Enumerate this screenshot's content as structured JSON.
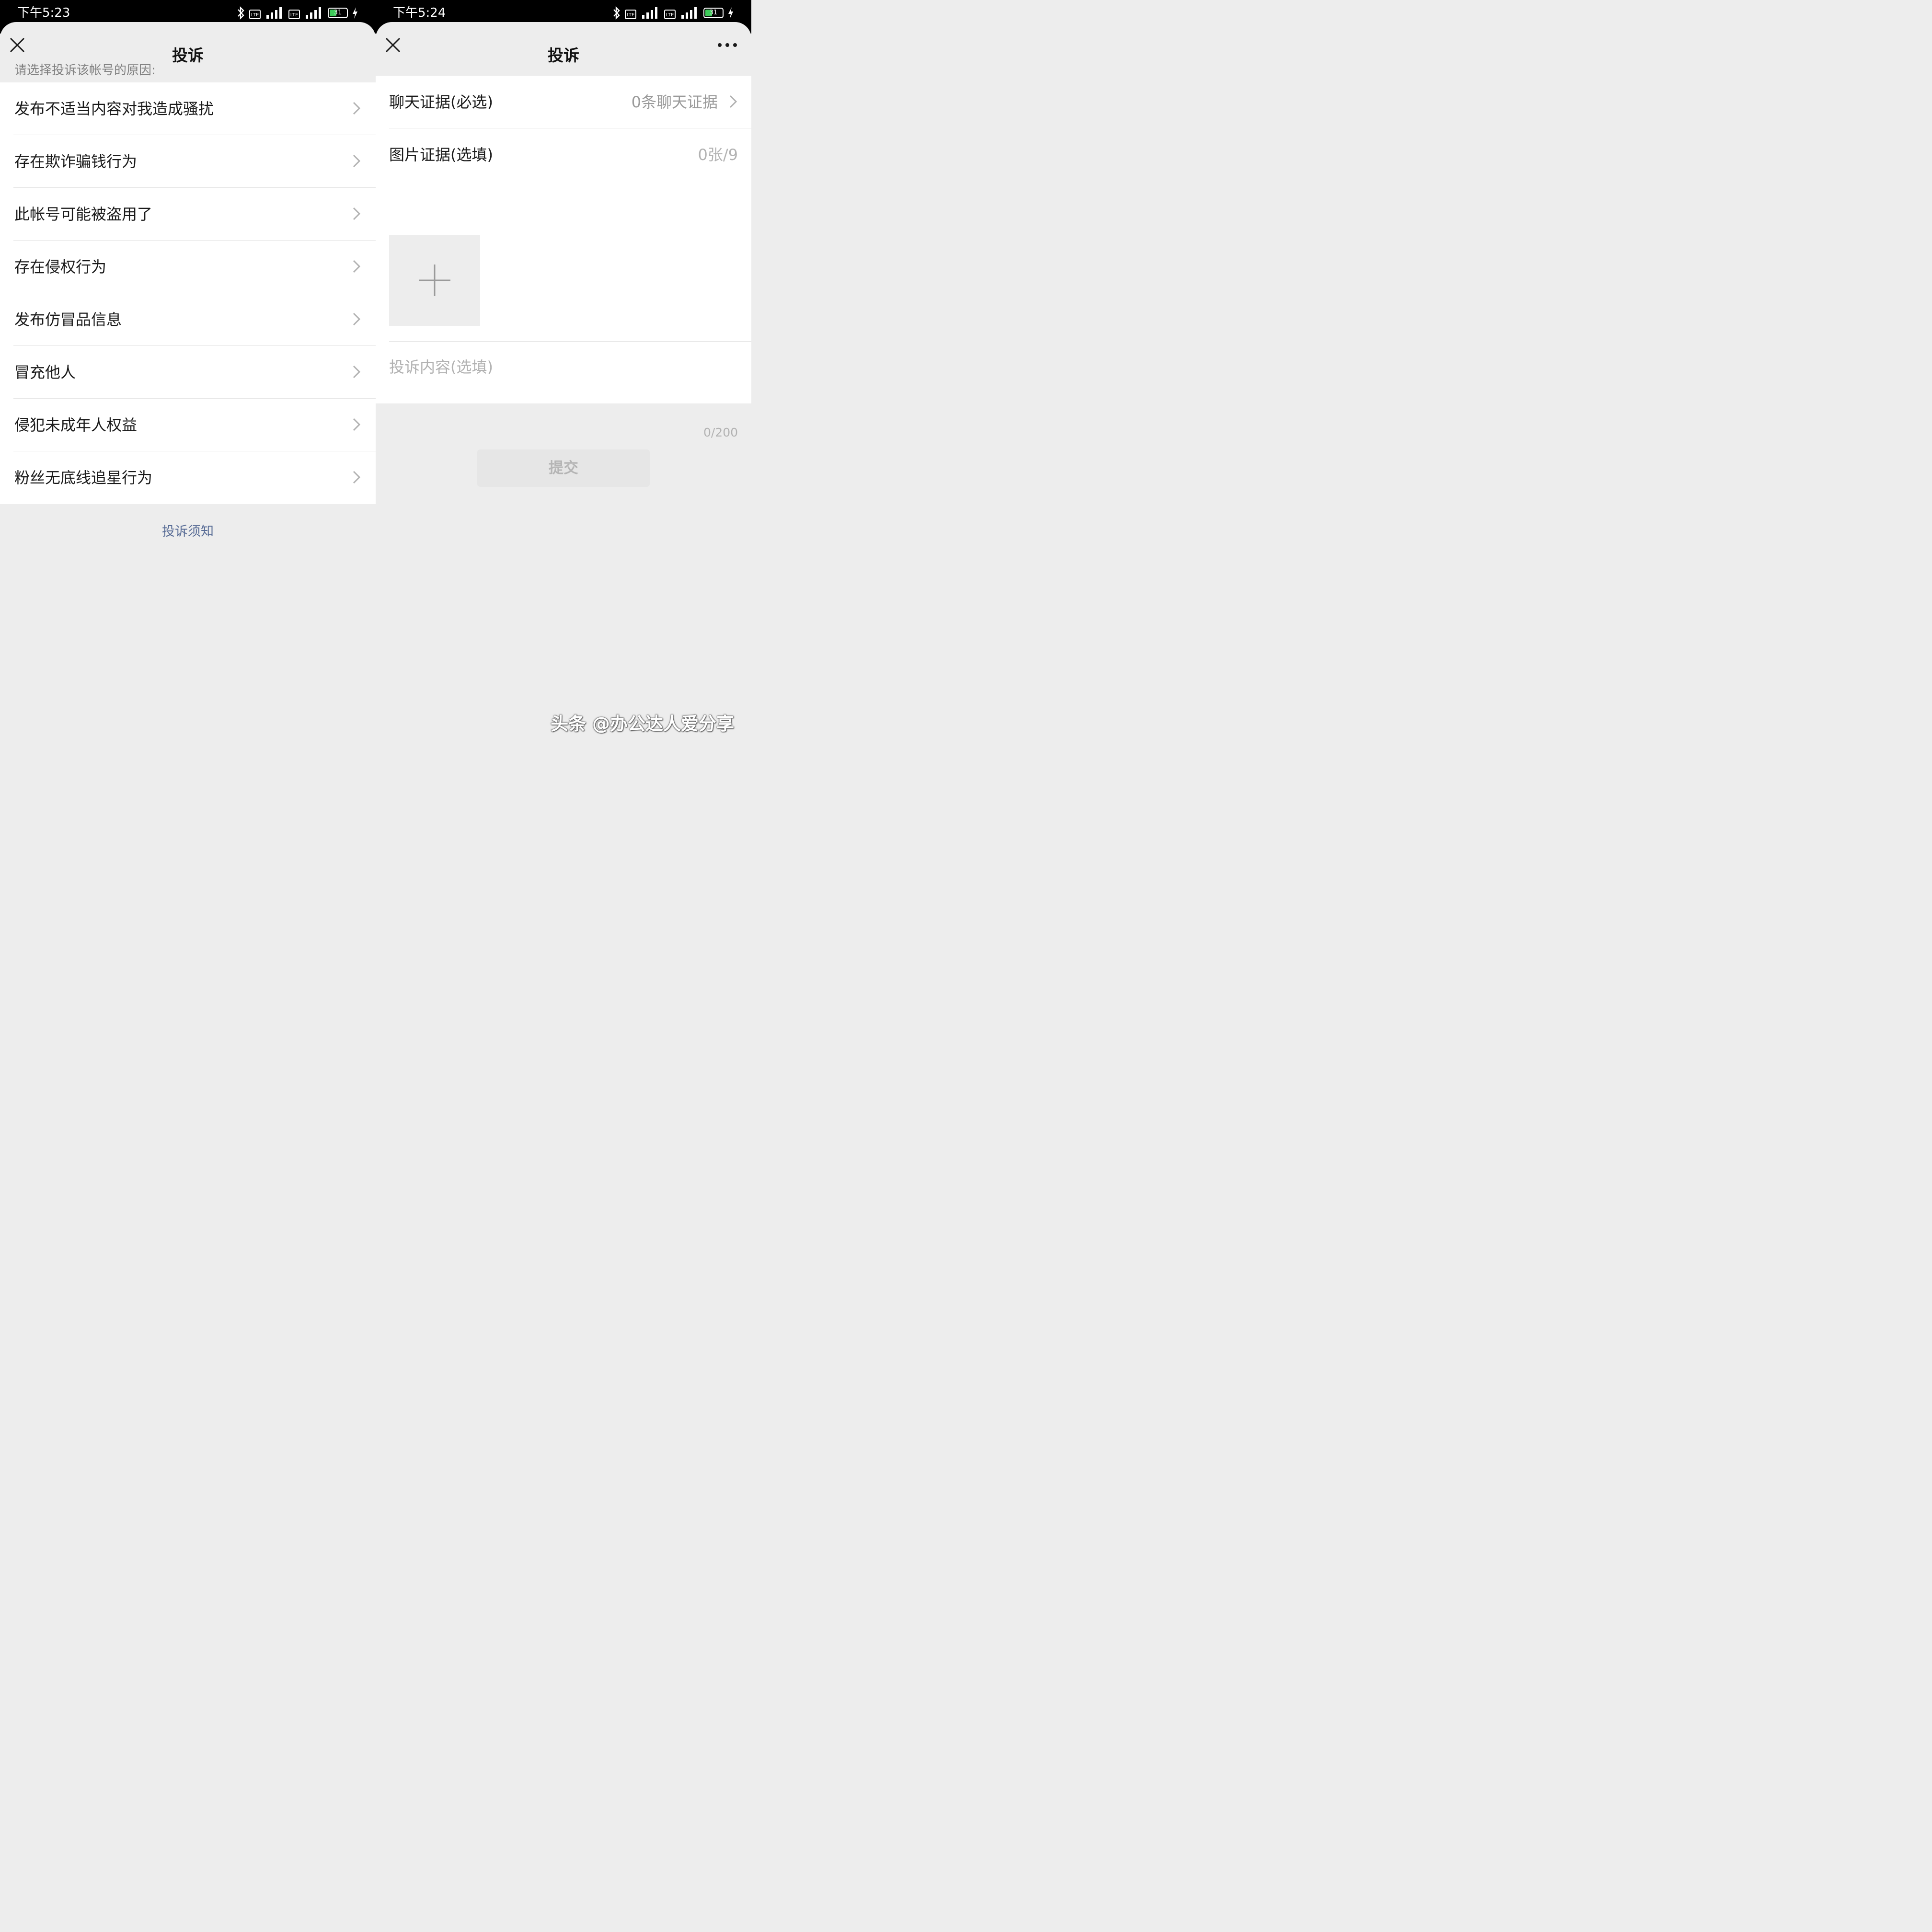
{
  "left": {
    "status_time": "下午5:23",
    "battery": "31",
    "title": "投诉",
    "section_label": "请选择投诉该帐号的原因:",
    "reasons": [
      "发布不适当内容对我造成骚扰",
      "存在欺诈骗钱行为",
      "此帐号可能被盗用了",
      "存在侵权行为",
      "发布仿冒品信息",
      "冒充他人",
      "侵犯未成年人权益",
      "粉丝无底线追星行为"
    ],
    "notice_link": "投诉须知"
  },
  "right": {
    "status_time": "下午5:24",
    "battery": "31",
    "title": "投诉",
    "chat_evidence_label": "聊天证据(必选)",
    "chat_evidence_value": "0条聊天证据",
    "image_evidence_label": "图片证据(选填)",
    "image_evidence_count": "0张/9",
    "content_placeholder": "投诉内容(选填)",
    "char_count": "0/200",
    "submit_label": "提交"
  },
  "watermark": "头条 @办公达人爱分享",
  "colors": {
    "link": "#576b95",
    "background": "#ededed",
    "card": "#ffffff",
    "status_bar": "#000000",
    "battery_fill": "#3ecb5a"
  },
  "icons": [
    "close-icon",
    "more-icon",
    "chevron-right-icon",
    "plus-icon",
    "bluetooth-icon",
    "signal-icon",
    "battery-icon",
    "charging-icon"
  ]
}
